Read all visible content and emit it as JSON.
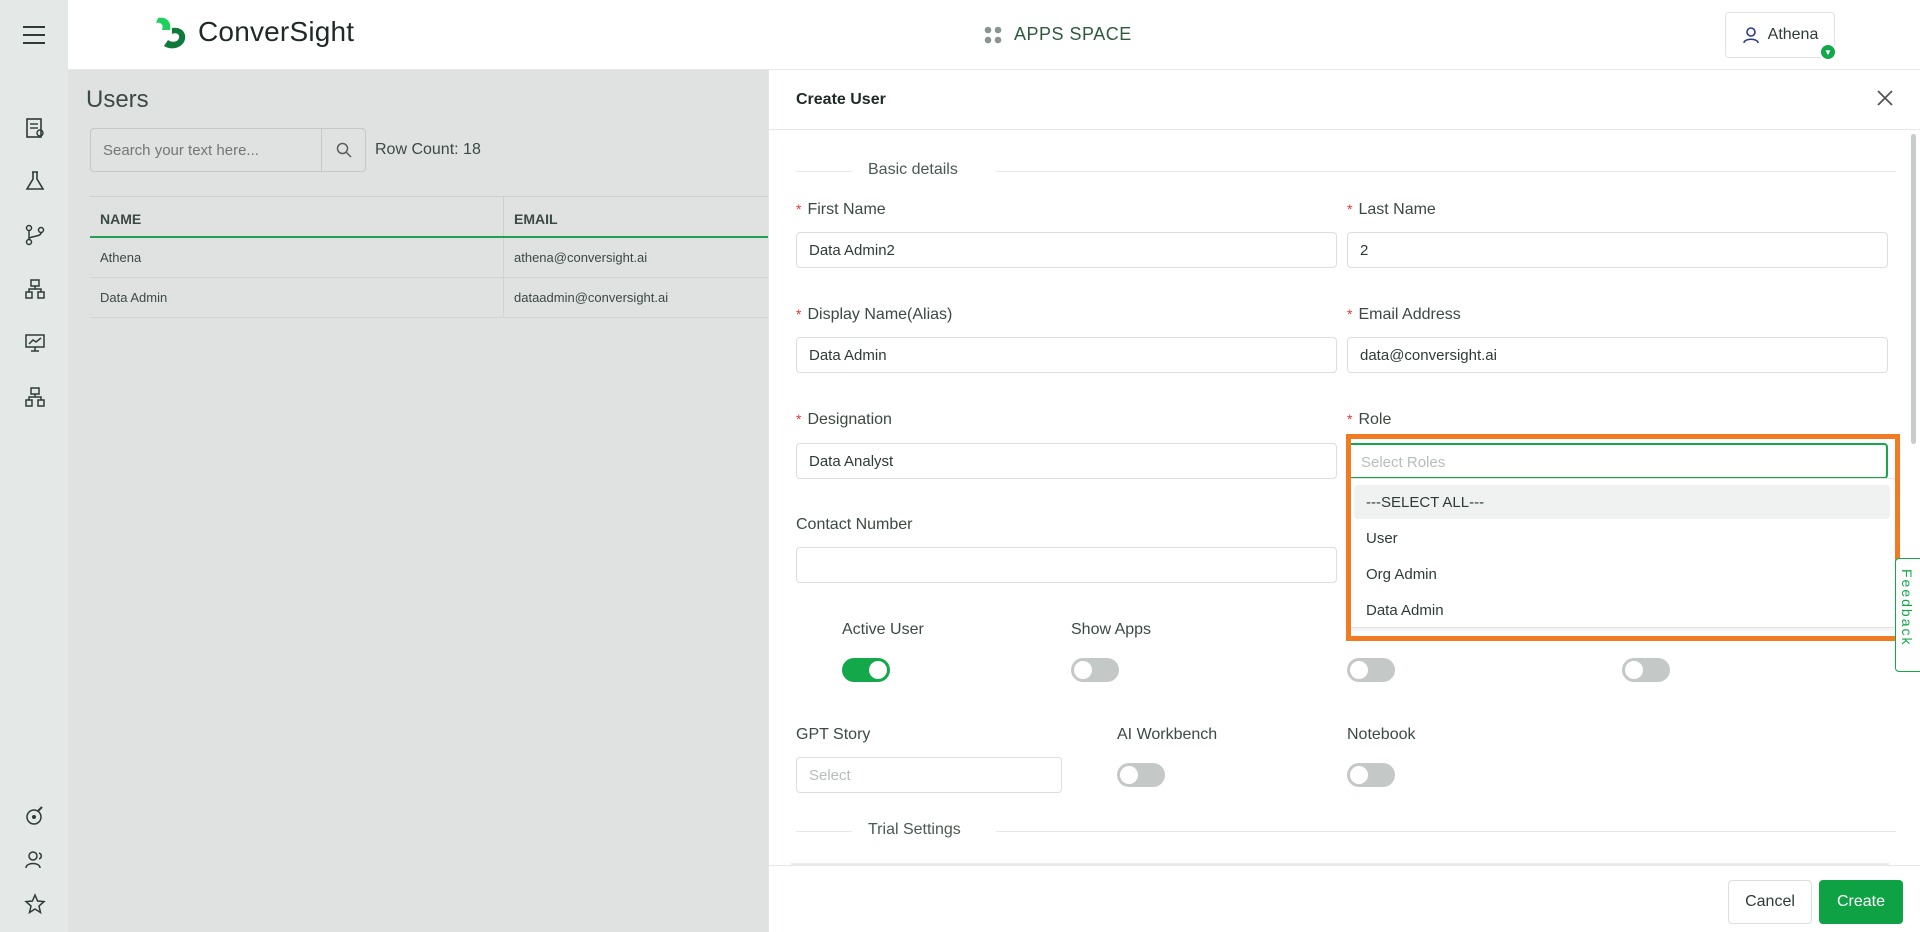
{
  "header": {
    "brand": "ConverSight",
    "apps_space": "APPS SPACE",
    "user_name": "Athena"
  },
  "colors": {
    "accent": "#13a84a",
    "highlight": "#f07b23",
    "sidebar_bg": "#e4e9e7"
  },
  "sidebar": {
    "icons": [
      "reports-icon",
      "flask-icon",
      "branch-icon",
      "hierarchy-icon",
      "presentation-icon",
      "org-chart-icon",
      "rocket-icon",
      "users-icon",
      "star-icon"
    ]
  },
  "users_page": {
    "title": "Users",
    "search_placeholder": "Search your text here...",
    "row_count": "Row Count: 18",
    "columns": [
      "NAME",
      "EMAIL"
    ],
    "rows": [
      {
        "name": "Athena",
        "email": "athena@conversight.ai"
      },
      {
        "name": "Data Admin",
        "email": "dataadmin@conversight.ai"
      }
    ]
  },
  "create_user": {
    "title": "Create User",
    "basic_details": "Basic details",
    "first_name_label": "First Name",
    "first_name_value": "Data Admin2",
    "last_name_label": "Last Name",
    "last_name_value": "2",
    "display_name_label": "Display Name(Alias)",
    "display_name_value": "Data Admin",
    "email_label": "Email Address",
    "email_value": "data@conversight.ai",
    "designation_label": "Designation",
    "designation_value": "Data Analyst",
    "role_label": "Role",
    "role_placeholder": "Select Roles",
    "role_options": [
      "---SELECT ALL---",
      "User",
      "Org Admin",
      "Data Admin"
    ],
    "contact_label": "Contact Number",
    "contact_value": "",
    "active_user_label": "Active User",
    "active_user_on": true,
    "show_apps_label": "Show Apps",
    "show_apps_on": false,
    "toggle3_on": false,
    "toggle4_on": false,
    "gpt_story_label": "GPT Story",
    "gpt_story_placeholder": "Select",
    "ai_workbench_label": "AI Workbench",
    "ai_workbench_on": false,
    "notebook_label": "Notebook",
    "notebook_on": false,
    "trial_settings": "Trial Settings",
    "feedback": "Feedback",
    "cancel": "Cancel",
    "create": "Create"
  }
}
